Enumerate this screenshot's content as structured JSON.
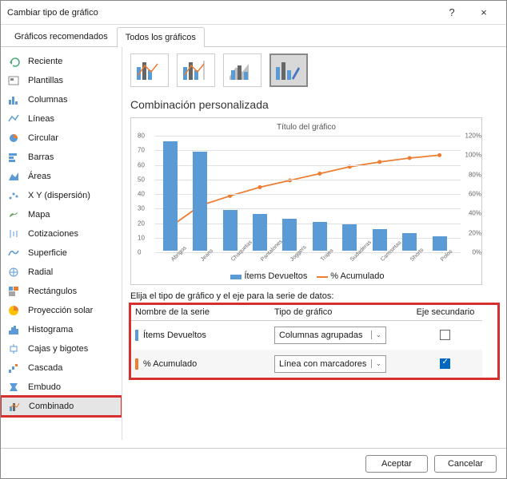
{
  "window": {
    "title": "Cambiar tipo de gráfico",
    "help": "?",
    "close": "×"
  },
  "tabs": {
    "recommended": "Gráficos recomendados",
    "all": "Todos los gráficos",
    "active": "all"
  },
  "sidebar": [
    {
      "label": "Reciente"
    },
    {
      "label": "Plantillas"
    },
    {
      "label": "Columnas"
    },
    {
      "label": "Líneas"
    },
    {
      "label": "Circular"
    },
    {
      "label": "Barras"
    },
    {
      "label": "Áreas"
    },
    {
      "label": "X Y (dispersión)"
    },
    {
      "label": "Mapa"
    },
    {
      "label": "Cotizaciones"
    },
    {
      "label": "Superficie"
    },
    {
      "label": "Radial"
    },
    {
      "label": "Rectángulos"
    },
    {
      "label": "Proyección solar"
    },
    {
      "label": "Histograma"
    },
    {
      "label": "Cajas y bigotes"
    },
    {
      "label": "Cascada"
    },
    {
      "label": "Embudo"
    },
    {
      "label": "Combinado"
    }
  ],
  "section_title": "Combinación personalizada",
  "chart_data": {
    "type": "combo",
    "title": "Título del gráfico",
    "categories": [
      "Abrigos",
      "Jeans",
      "Chaquetas",
      "Pantalones",
      "Joggers",
      "Trajes",
      "Sudaderas",
      "Camisetas",
      "Shorts",
      "Polos"
    ],
    "series": [
      {
        "name": "Ítems Devueltos",
        "type": "bar",
        "axis": "primary",
        "color": "#5b9bd5",
        "values": [
          75,
          68,
          28,
          25,
          22,
          20,
          18,
          15,
          12,
          10
        ]
      },
      {
        "name": "% Acumulado",
        "type": "line",
        "axis": "secondary",
        "color": "#ed7d31",
        "values": [
          26,
          48,
          58,
          67,
          74,
          81,
          88,
          93,
          97,
          100
        ]
      }
    ],
    "ylim": [
      0,
      80
    ],
    "yticks": [
      0,
      10,
      20,
      30,
      40,
      50,
      60,
      70,
      80
    ],
    "y2lim": [
      0,
      120
    ],
    "y2ticks": [
      "0%",
      "20%",
      "40%",
      "60%",
      "80%",
      "100%",
      "120%"
    ],
    "legend": [
      {
        "label": "Ítems Devueltos",
        "color": "#5b9bd5"
      },
      {
        "label": "% Acumulado",
        "color": "#ed7d31"
      }
    ]
  },
  "series_section": {
    "instruction": "Elija el tipo de gráfico y el eje para la serie de datos:",
    "col_name": "Nombre de la serie",
    "col_type": "Tipo de gráfico",
    "col_axis": "Eje secundario",
    "rows": [
      {
        "color": "#5b9bd5",
        "name": "Ítems Devueltos",
        "type": "Columnas agrupadas",
        "secondary": false
      },
      {
        "color": "#ed7d31",
        "name": "% Acumulado",
        "type": "Línea con marcadores",
        "secondary": true
      }
    ]
  },
  "footer": {
    "ok": "Aceptar",
    "cancel": "Cancelar"
  }
}
